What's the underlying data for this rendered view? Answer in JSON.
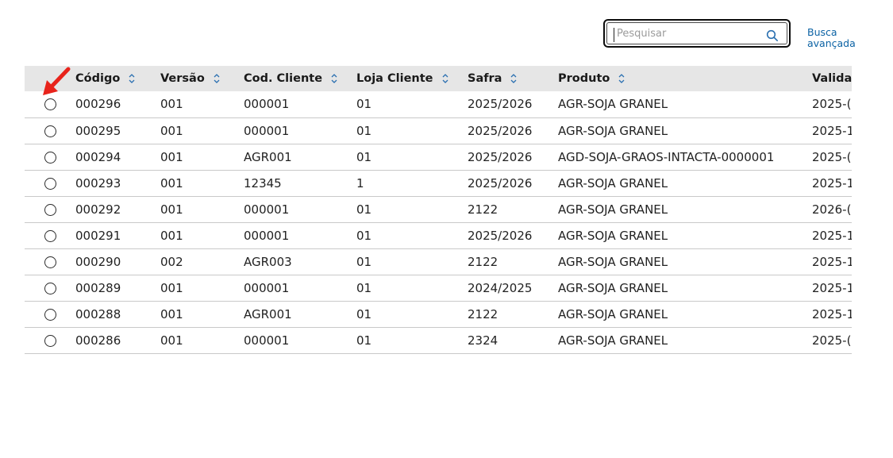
{
  "search": {
    "placeholder": "Pesquisar",
    "value": ""
  },
  "advanced_search": {
    "label": "Busca avançada"
  },
  "table": {
    "columns": [
      {
        "key": "codigo",
        "label": "Código"
      },
      {
        "key": "versao",
        "label": "Versão"
      },
      {
        "key": "cod_cliente",
        "label": "Cod. Cliente"
      },
      {
        "key": "loja_cliente",
        "label": "Loja Cliente"
      },
      {
        "key": "safra",
        "label": "Safra"
      },
      {
        "key": "produto",
        "label": "Produto"
      },
      {
        "key": "validade",
        "label": "Validad"
      }
    ],
    "rows": [
      {
        "codigo": "000296",
        "versao": "001",
        "cod_cliente": "000001",
        "loja_cliente": "01",
        "safra": "2025/2026",
        "produto": "AGR-SOJA GRANEL",
        "validade": "2025-("
      },
      {
        "codigo": "000295",
        "versao": "001",
        "cod_cliente": "000001",
        "loja_cliente": "01",
        "safra": "2025/2026",
        "produto": "AGR-SOJA GRANEL",
        "validade": "2025-1"
      },
      {
        "codigo": "000294",
        "versao": "001",
        "cod_cliente": "AGR001",
        "loja_cliente": "01",
        "safra": "2025/2026",
        "produto": "AGD-SOJA-GRAOS-INTACTA-0000001",
        "validade": "2025-("
      },
      {
        "codigo": "000293",
        "versao": "001",
        "cod_cliente": "12345",
        "loja_cliente": "1",
        "safra": "2025/2026",
        "produto": "AGR-SOJA GRANEL",
        "validade": "2025-1"
      },
      {
        "codigo": "000292",
        "versao": "001",
        "cod_cliente": "000001",
        "loja_cliente": "01",
        "safra": "2122",
        "produto": "AGR-SOJA GRANEL",
        "validade": "2026-("
      },
      {
        "codigo": "000291",
        "versao": "001",
        "cod_cliente": "000001",
        "loja_cliente": "01",
        "safra": "2025/2026",
        "produto": "AGR-SOJA GRANEL",
        "validade": "2025-1"
      },
      {
        "codigo": "000290",
        "versao": "002",
        "cod_cliente": "AGR003",
        "loja_cliente": "01",
        "safra": "2122",
        "produto": "AGR-SOJA GRANEL",
        "validade": "2025-1"
      },
      {
        "codigo": "000289",
        "versao": "001",
        "cod_cliente": "000001",
        "loja_cliente": "01",
        "safra": "2024/2025",
        "produto": "AGR-SOJA GRANEL",
        "validade": "2025-1"
      },
      {
        "codigo": "000288",
        "versao": "001",
        "cod_cliente": "AGR001",
        "loja_cliente": "01",
        "safra": "2122",
        "produto": "AGR-SOJA GRANEL",
        "validade": "2025-1"
      },
      {
        "codigo": "000286",
        "versao": "001",
        "cod_cliente": "000001",
        "loja_cliente": "01",
        "safra": "2324",
        "produto": "AGR-SOJA GRANEL",
        "validade": "2025-("
      }
    ]
  },
  "icons": {
    "search": "search-icon",
    "sort": "sort-icon",
    "row_select": "radio-button",
    "pointer": "red-arrow-pointer"
  },
  "colors": {
    "link": "#0b62a4",
    "header_bg": "#e6e6e6",
    "arrow": "#e8231b"
  }
}
